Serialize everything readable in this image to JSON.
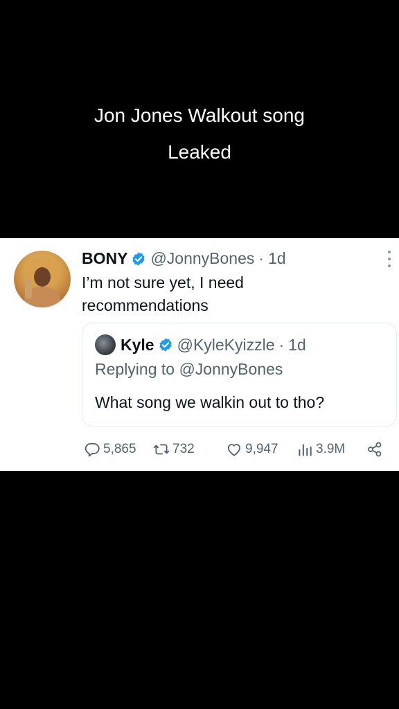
{
  "caption": {
    "line1": "Jon Jones Walkout song",
    "line2": "Leaked"
  },
  "tweet": {
    "name": "BONY",
    "handle": "@JonnyBones",
    "separator": "·",
    "time": "1d",
    "text": "I’m not sure yet, I need recommendations",
    "verified_icon": "verified-badge-icon",
    "verified_color": "#1d9bf0"
  },
  "quote": {
    "name": "Kyle",
    "handle": "@KyleKyizzle",
    "separator": "·",
    "time": "1d",
    "replying_to": "Replying to @JonnyBones",
    "text": "What song we walkin out to tho?"
  },
  "actions": {
    "replies": "5,865",
    "retweets": "732",
    "likes": "9,947",
    "views": "3.9M"
  },
  "colors": {
    "background": "#000000",
    "card": "#ffffff",
    "text": "#0f1419",
    "muted": "#536471"
  }
}
